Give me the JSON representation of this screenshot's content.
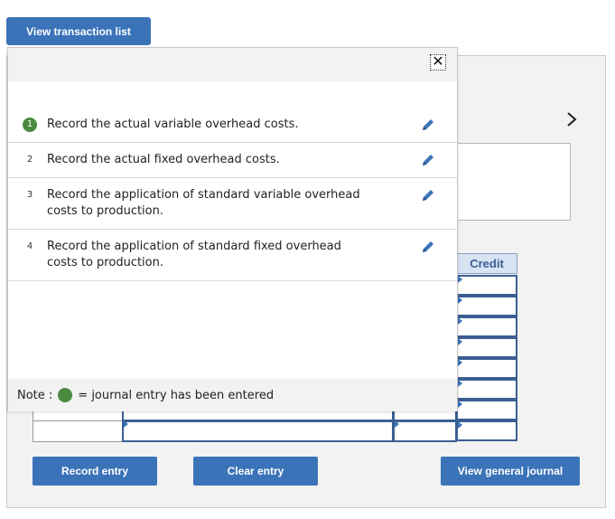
{
  "header": {
    "view_transactions_label": "View transaction list"
  },
  "popup": {
    "close_glyph": "✕",
    "tasks": [
      {
        "number": "1",
        "text": "Record the actual variable overhead costs.",
        "completed": true
      },
      {
        "number": "2",
        "text": "Record the actual fixed overhead costs.",
        "completed": false
      },
      {
        "number": "3",
        "text": "Record the application of standard variable overhead costs to production.",
        "completed": false
      },
      {
        "number": "4",
        "text": "Record the application of standard fixed overhead costs to production.",
        "completed": false
      }
    ],
    "note": {
      "prefix": "Note :",
      "suffix": "= journal entry has been entered"
    }
  },
  "workspace": {
    "nav_glyph": "›",
    "credit_header": "Credit"
  },
  "actions": {
    "record_label": "Record entry",
    "clear_label": "Clear entry",
    "view_journal_label": "View general journal"
  },
  "colors": {
    "accent": "#3b73b9",
    "completed": "#4a8a3f",
    "panel": "#f2f2f2"
  }
}
